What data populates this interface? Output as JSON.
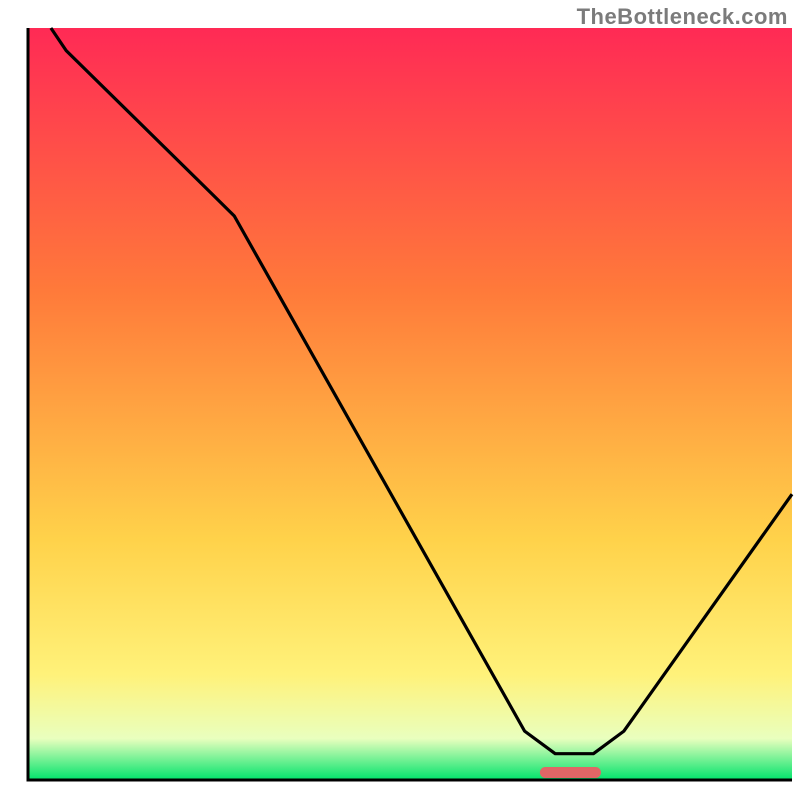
{
  "watermark": "TheBottleneck.com",
  "chart_data": {
    "type": "line",
    "title": "",
    "xlabel": "",
    "ylabel": "",
    "xlim": [
      0,
      100
    ],
    "ylim": [
      0,
      100
    ],
    "background_gradient": {
      "top": "#ff2a55",
      "mid1": "#ff7a3a",
      "mid2": "#ffd24a",
      "mid3": "#fff27a",
      "mid4": "#e9ffbe",
      "bottom": "#00e36b"
    },
    "series": [
      {
        "name": "bottleneck-curve",
        "color": "#000000",
        "type": "line",
        "x": [
          3,
          5,
          24,
          27,
          65,
          69,
          74,
          78,
          100
        ],
        "y": [
          100,
          97,
          78,
          75,
          6.5,
          3.5,
          3.5,
          6.5,
          38
        ]
      },
      {
        "name": "optimal-marker",
        "color": "#e06666",
        "type": "bar",
        "x": [
          67,
          75
        ],
        "y": [
          3,
          3
        ]
      }
    ],
    "axes": {
      "stroke": "#000000",
      "stroke_width": 3
    }
  }
}
